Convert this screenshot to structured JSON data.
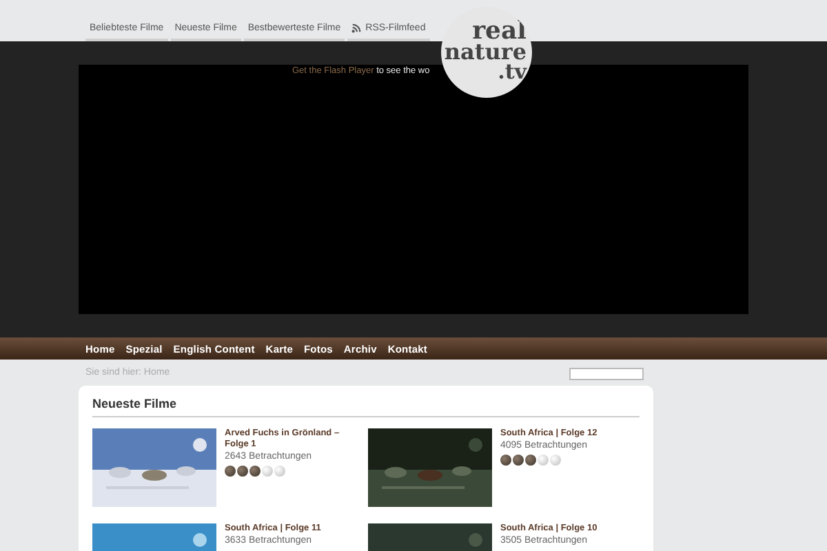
{
  "top_tabs": [
    {
      "label": "Beliebteste Filme",
      "kind": "plain"
    },
    {
      "label": "Neueste Filme",
      "kind": "plain"
    },
    {
      "label": "Bestbewerteste Filme",
      "kind": "plain"
    },
    {
      "label": "RSS-Filmfeed",
      "kind": "rss"
    }
  ],
  "logo": {
    "lines": [
      "real",
      "nature",
      ".tv"
    ]
  },
  "player": {
    "link": "Get the Flash Player",
    "text": "to see the wo"
  },
  "nav": [
    "Home",
    "Spezial",
    "English Content",
    "Karte",
    "Fotos",
    "Archiv",
    "Kontakt"
  ],
  "breadcrumb": "Sie sind hier: Home",
  "section": {
    "title": "Neueste Filme",
    "films": [
      {
        "title": "Arved Fuchs in Grönland – Folge 1",
        "views": "2643 Betrachtungen",
        "stars": 3,
        "kind": "picture"
      },
      {
        "title": "South Africa | Folge 12",
        "views": "4095 Betrachtungen",
        "stars": 3,
        "kind": "picture"
      },
      {
        "title": "South Africa | Folge 11",
        "views": "3633 Betrachtungen",
        "kind": "picture"
      },
      {
        "title": "South Africa | Folge 10",
        "views": "3505 Betrachtungen",
        "kind": "picture"
      }
    ]
  }
}
